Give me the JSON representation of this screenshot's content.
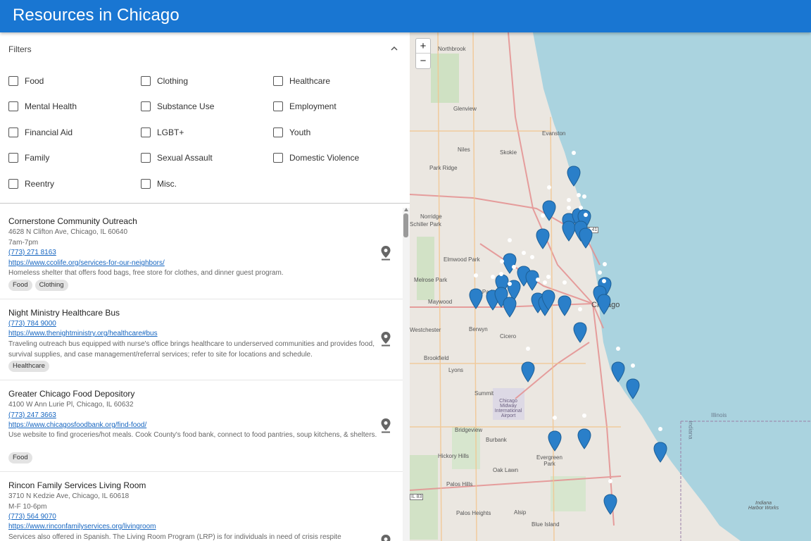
{
  "app": {
    "title": "Resources in Chicago"
  },
  "filters": {
    "label": "Filters",
    "categories": [
      "Food",
      "Clothing",
      "Healthcare",
      "Mental Health",
      "Substance Use",
      "Employment",
      "Financial Aid",
      "LGBT+",
      "Youth",
      "Family",
      "Sexual Assault",
      "Domestic Violence",
      "Reentry",
      "Misc."
    ],
    "checked": []
  },
  "resources": [
    {
      "name": "Cornerstone Community Outreach",
      "address": "4628 N Clifton Ave, Chicago, IL 60640",
      "hours": "7am-7pm",
      "phone": "(773) 271 8163",
      "url": "https://www.ccolife.org/services-for-our-neighbors/",
      "description": "Homeless shelter that offers food bags, free store for clothes, and dinner guest program.",
      "tags": [
        "Food",
        "Clothing"
      ]
    },
    {
      "name": "Night Ministry Healthcare Bus",
      "phone": "(773) 784 9000",
      "url": "https://www.thenightministry.org/healthcare#bus",
      "description": "Traveling outreach bus equipped with nurse's office brings healthcare to underserved communities and provides food, survival supplies, and case management/referral services; refer to site for locations and schedule.",
      "tags": [
        "Healthcare"
      ]
    },
    {
      "name": "Greater Chicago Food Depository",
      "address": "4100 W Ann Lurie Pl, Chicago, IL 60632",
      "phone": "(773) 247 3663",
      "url": "https://www.chicagosfoodbank.org/find-food/",
      "description": "Use website to find groceries/hot meals. Cook County's food bank, connect to food pantries, soup kitchens, & shelters.",
      "tags": [
        "Food"
      ]
    },
    {
      "name": "Rincon Family Services Living Room",
      "address": "3710 N Kedzie Ave, Chicago, IL 60618",
      "hours": "M-F 10-6pm",
      "phone": "(773) 564 9070",
      "url": "https://www.rinconfamilyservices.org/livingroom",
      "description": "Services also offered in Spanish. The Living Room Program (LRP) is for individuals in need of crisis respite"
    }
  ],
  "map": {
    "zoom_in": "+",
    "zoom_out": "−",
    "places": [
      "Northbrook",
      "Glenview",
      "Evanston",
      "Skokie",
      "Niles",
      "Park Ridge",
      "Norridge",
      "Schiller Park",
      "Elmwood Park",
      "Melrose Park",
      "Oak Park",
      "Maywood",
      "Chicago",
      "Berwyn",
      "Cicero",
      "Westchester",
      "Brookfield",
      "Lyons",
      "Summit",
      "Chicago Midway International Airport",
      "Bridgeview",
      "Burbank",
      "Hickory Hills",
      "Oak Lawn",
      "Evergreen Park",
      "Palos Hills",
      "Alsip",
      "Blue Island",
      "Palos Heights",
      "Illinois",
      "Indiana",
      "Indiana Harbor Works",
      "US 41",
      "IL 83"
    ],
    "marker_color": "#2a7fc9",
    "water_color": "#aad3df"
  }
}
